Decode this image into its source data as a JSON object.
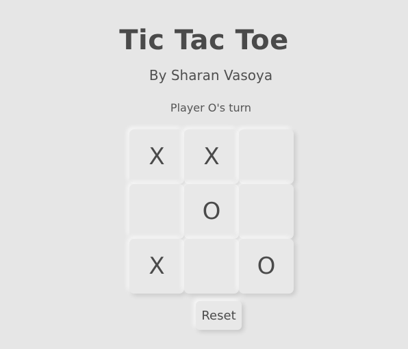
{
  "header": {
    "title": "Tic Tac Toe",
    "subtitle": "By Sharan Vasoya"
  },
  "status": "Player O's turn",
  "board": {
    "cells": [
      "X",
      "X",
      "",
      "",
      "O",
      "",
      "X",
      "",
      "O"
    ]
  },
  "controls": {
    "reset_label": "Reset"
  },
  "colors": {
    "background": "#e6e6e6",
    "text": "#4a4a4a",
    "cell": "#e8e8e8"
  }
}
